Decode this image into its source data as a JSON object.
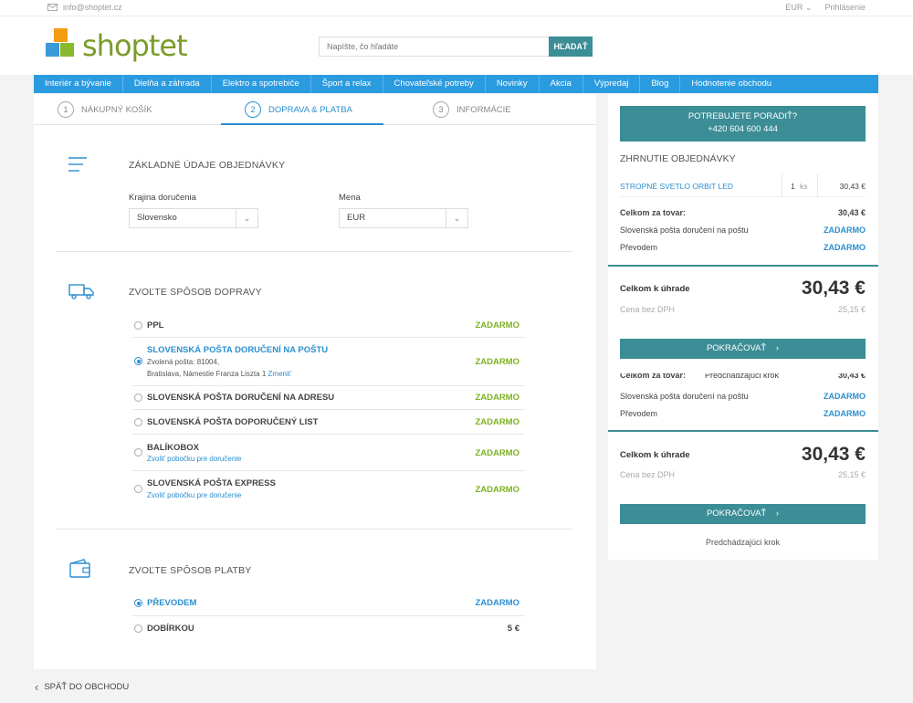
{
  "topbar": {
    "email": "info@shoptet.cz",
    "currency": "EUR",
    "login": "Prihlásenie"
  },
  "logo": {
    "text": "shoptet"
  },
  "search": {
    "placeholder": "Napíšte, čo hľadáte",
    "button": "HĽADAŤ"
  },
  "nav": [
    "Interiér a bývanie",
    "Dielňa a záhrada",
    "Elektro a spotrebiče",
    "Šport a relax",
    "Chovateľské potreby",
    "Novinky",
    "Akcia",
    "Výpredaj",
    "Blog",
    "Hodnotenie obchodu"
  ],
  "steps": [
    {
      "num": "1",
      "label": "NÁKUPNÝ KOŠÍK"
    },
    {
      "num": "2",
      "label": "DOPRAVA & PLATBA"
    },
    {
      "num": "3",
      "label": "INFORMÁCIE"
    }
  ],
  "basic": {
    "title": "ZÁKLADNÉ ÚDAJE OBJEDNÁVKY",
    "country_label": "Krajina doručenia",
    "country_value": "Slovensko",
    "currency_label": "Mena",
    "currency_value": "EUR"
  },
  "shipping": {
    "title": "ZVOĽTE SPÔSOB DOPRAVY",
    "options": [
      {
        "name": "PPL",
        "price": "ZADARMO"
      },
      {
        "name": "SLOVENSKÁ POŠTA DORUČENÍ NA POŠTU",
        "price": "ZADARMO",
        "detail1": "Zvolená pošta: 81004,",
        "detail2": "Bratislava, Námestie Franza Liszta 1",
        "change": "Zmeniť"
      },
      {
        "name": "SLOVENSKÁ POŠTA DORUČENÍ NA ADRESU",
        "price": "ZADARMO"
      },
      {
        "name": "SLOVENSKÁ POŠTA DOPORUČENÝ LIST",
        "price": "ZADARMO"
      },
      {
        "name": "BALÍKOBOX",
        "price": "ZADARMO",
        "sub": "Zvoliť pobočku pre doručenie"
      },
      {
        "name": "SLOVENSKÁ POŠTA EXPRESS",
        "price": "ZADARMO",
        "sub": "Zvoliť pobočku pre doručenie"
      }
    ]
  },
  "payment": {
    "title": "ZVOĽTE SPÔSOB PLATBY",
    "options": [
      {
        "name": "PŘEVODEM",
        "price": "ZADARMO"
      },
      {
        "name": "DOBÍRKOU",
        "price": "5 €"
      }
    ]
  },
  "sidebar": {
    "help_line1": "POTREBUJETE PORADIŤ?",
    "help_line2": "+420 604 600 444",
    "summary_title": "ZHRNUTIE OBJEDNÁVKY",
    "item_name": "STROPNÉ SVETLO ORBIT LED",
    "item_qty": "1",
    "item_unit": "ks",
    "item_price": "30,43 €",
    "goods_total_label": "Celkom za tovar:",
    "goods_total_value": "30,43 €",
    "shipping_label": "Slovenská pošta doručení na poštu",
    "shipping_value": "ZADARMO",
    "payment_label": "Převodem",
    "payment_value": "ZADARMO",
    "total_label": "Celkom k úhrade",
    "total_value": "30,43 €",
    "net_label": "Cena bez DPH",
    "net_value": "25,15 €",
    "continue": "POKRAČOVAŤ",
    "prev_step": "Predchádzajúci krok"
  },
  "back": "SPÄŤ DO OBCHODU",
  "colors": {
    "accent": "#2b9be0",
    "teal": "#3b8d96",
    "green": "#7cb221"
  }
}
